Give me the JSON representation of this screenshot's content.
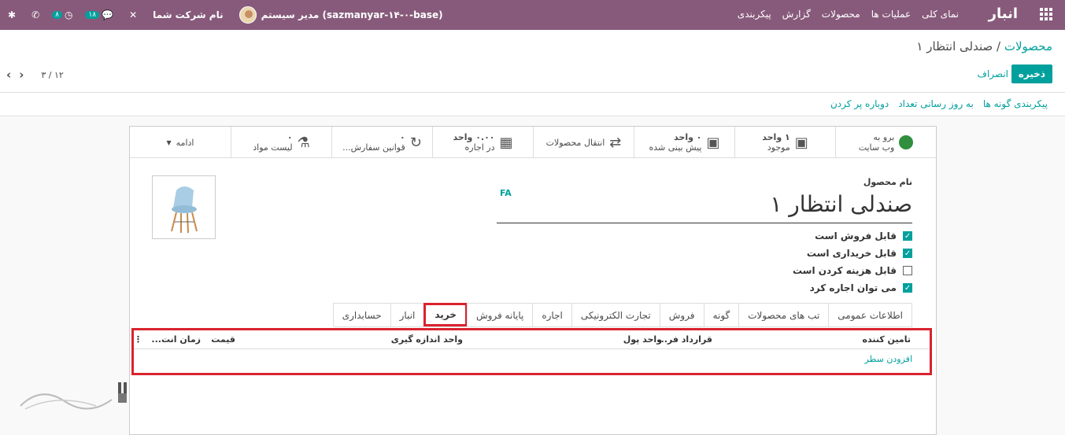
{
  "navbar": {
    "brand": "انبار",
    "menu": [
      "نمای کلی",
      "عملیات ها",
      "محصولات",
      "گزارش",
      "پیکربندی"
    ],
    "company": "نام شرکت شما",
    "user": "مدیر سیستم (sazmanyar-۱۴-۰-base)",
    "messages_badge": "۱۸",
    "activities_badge": "۸"
  },
  "control": {
    "breadcrumb_parent": "محصولات",
    "breadcrumb_sep": "/",
    "breadcrumb_current": "صندلی انتظار ۱",
    "save_label": "ذخیره",
    "discard_label": "انصراف",
    "pager_value": "۳ / ۱۲"
  },
  "statusbar": {
    "actions": [
      "پیکربندی گونه ها",
      "به روز رسانی تعداد",
      "دوباره پر کردن"
    ]
  },
  "smart_buttons": [
    {
      "line1": "برو به",
      "line2": "وب سایت",
      "icon": "globe-icon"
    },
    {
      "line1": "۱ واحد",
      "line2": "موجود",
      "icon": "cubes-icon"
    },
    {
      "line1": "۰ واحد",
      "line2": "پیش بینی شده",
      "icon": "cubes-icon"
    },
    {
      "line1": "",
      "line2": "انتقال محصولات",
      "icon": "exchange-icon"
    },
    {
      "line1": "۰.۰۰ واحد",
      "line2": "در اجاره",
      "icon": "calendar-icon"
    },
    {
      "line1": "۰",
      "line2": "قوانین سفارش...",
      "icon": "refresh-icon"
    },
    {
      "line1": "۰",
      "line2": "لیست مواد",
      "icon": "flask-icon"
    },
    {
      "line1": "",
      "line2": "ادامه",
      "icon": "caret-down-icon"
    }
  ],
  "form": {
    "name_label": "نام محصول",
    "name": "صندلی انتظار ۱",
    "lang": "FA",
    "checks": [
      {
        "label": "قابل فروش است",
        "checked": true
      },
      {
        "label": "قابل خریداری است",
        "checked": true
      },
      {
        "label": "قابل هزینه کردن است",
        "checked": false
      },
      {
        "label": "می توان اجاره کرد",
        "checked": true
      }
    ]
  },
  "tabs": [
    "اطلاعات عمومی",
    "تب های محصولات",
    "گونه",
    "فروش",
    "تجارت الکترونیکی",
    "اجاره",
    "پایانه فروش",
    "خرید",
    "انبار",
    "حسابداری"
  ],
  "active_tab": "خرید",
  "grid": {
    "columns": [
      "تامین کننده",
      "قرارداد فر...",
      "واحد پول",
      "واحد اندازه گیری",
      "قیمت",
      "زمان انت..."
    ],
    "add_line": "افزودن سطر"
  },
  "colors": {
    "navbar": "#875a7b",
    "accent": "#00a09d",
    "highlight": "#d9232e"
  }
}
